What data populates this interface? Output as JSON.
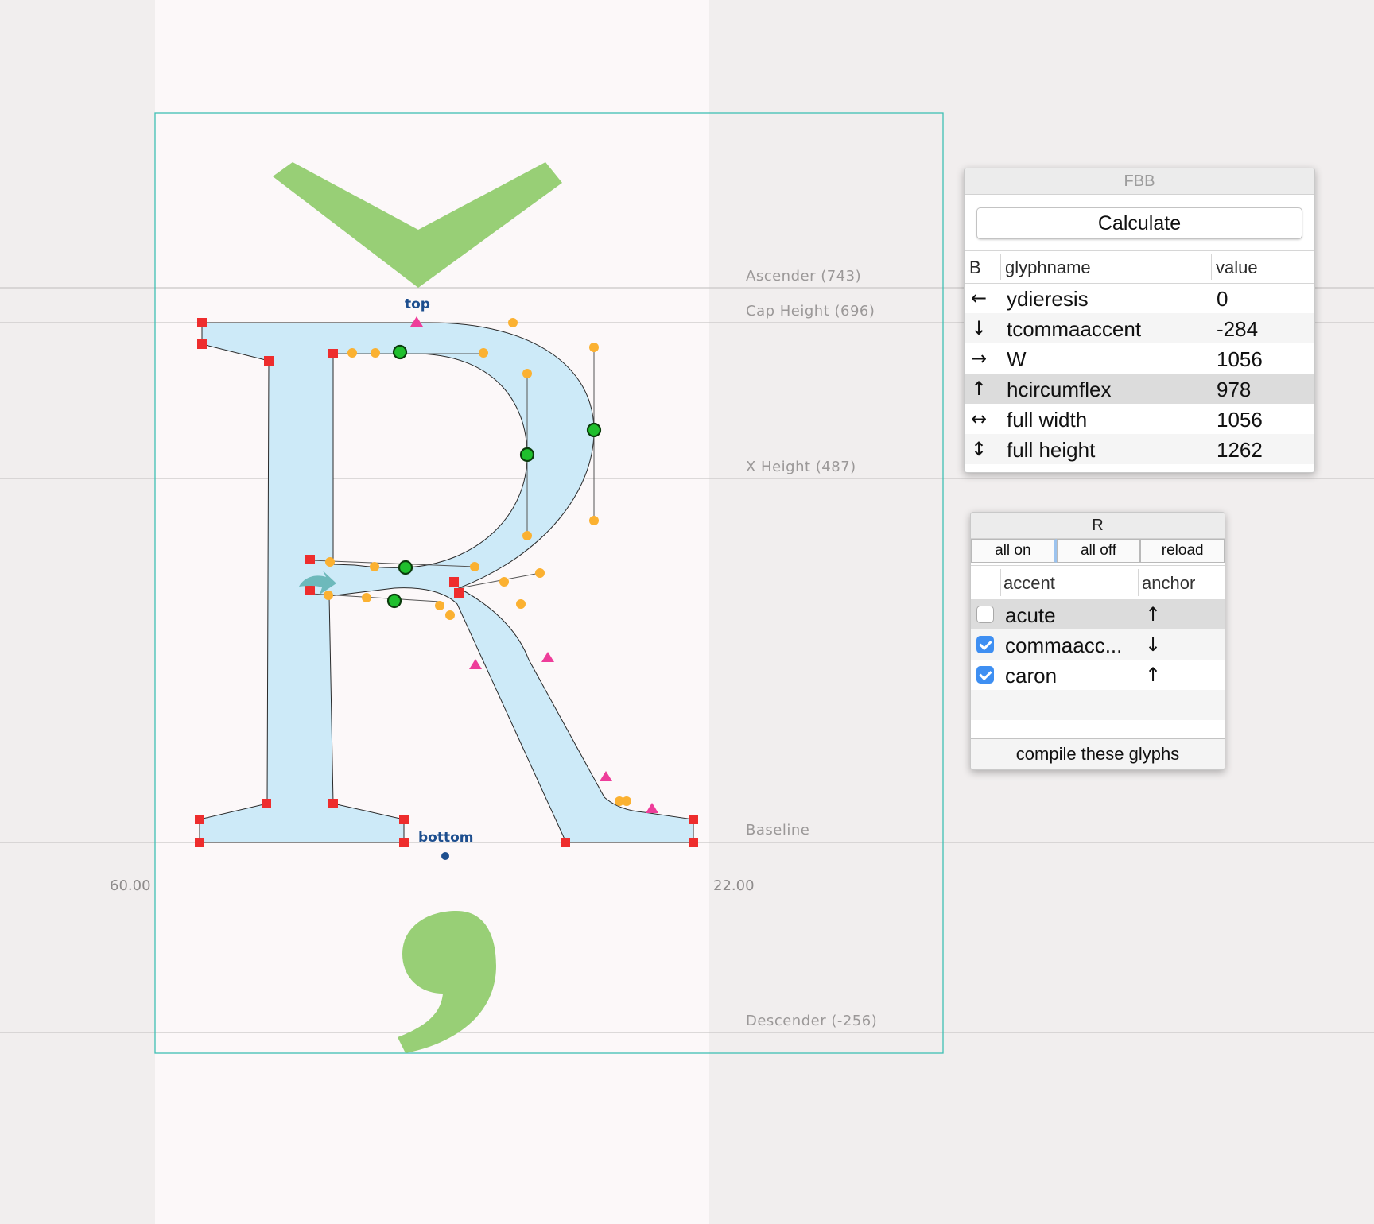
{
  "metrics": {
    "ascender": "Ascender (743)",
    "cap_height": "Cap Height (696)",
    "x_height": "X Height (487)",
    "baseline": "Baseline",
    "descender": "Descender (-256)"
  },
  "sidebearings": {
    "left": "60.00",
    "right": "22.00"
  },
  "anchors": {
    "top": "top",
    "bottom": "bottom"
  },
  "colors": {
    "glyph_fill": "#cdeaf8",
    "component_fill": "#98cf76",
    "on_curve": "#ee2d2d",
    "off_curve": "#fbb131",
    "smooth_point": "#1fbf2d",
    "tangent": "#ee3d9a",
    "bounds": "#3fbfb3",
    "checkbox_on": "#3e8ff2"
  },
  "fbb_panel": {
    "title": "FBB",
    "calculate_label": "Calculate",
    "columns": {
      "b": "B",
      "glyphname": "glyphname",
      "value": "value"
    },
    "rows": [
      {
        "arrow": "←",
        "glyphname": "ydieresis",
        "value": "0"
      },
      {
        "arrow": "↓",
        "glyphname": "tcommaaccent",
        "value": "-284"
      },
      {
        "arrow": "→",
        "glyphname": "W",
        "value": "1056"
      },
      {
        "arrow": "↑",
        "glyphname": "hcircumflex",
        "value": "978"
      },
      {
        "arrow": "↔",
        "glyphname": "full width",
        "value": "1056"
      },
      {
        "arrow": "↕",
        "glyphname": "full height",
        "value": "1262"
      }
    ]
  },
  "r_panel": {
    "title": "R",
    "all_on_label": "all on",
    "all_off_label": "all off",
    "reload_label": "reload",
    "columns": {
      "accent": "accent",
      "anchor": "anchor"
    },
    "rows": [
      {
        "accent": "acute",
        "anchor": "↑",
        "checked": false
      },
      {
        "accent": "commaacc...",
        "anchor": "↓",
        "checked": true
      },
      {
        "accent": "caron",
        "anchor": "↑",
        "checked": true
      }
    ],
    "compile_label": "compile these glyphs"
  }
}
